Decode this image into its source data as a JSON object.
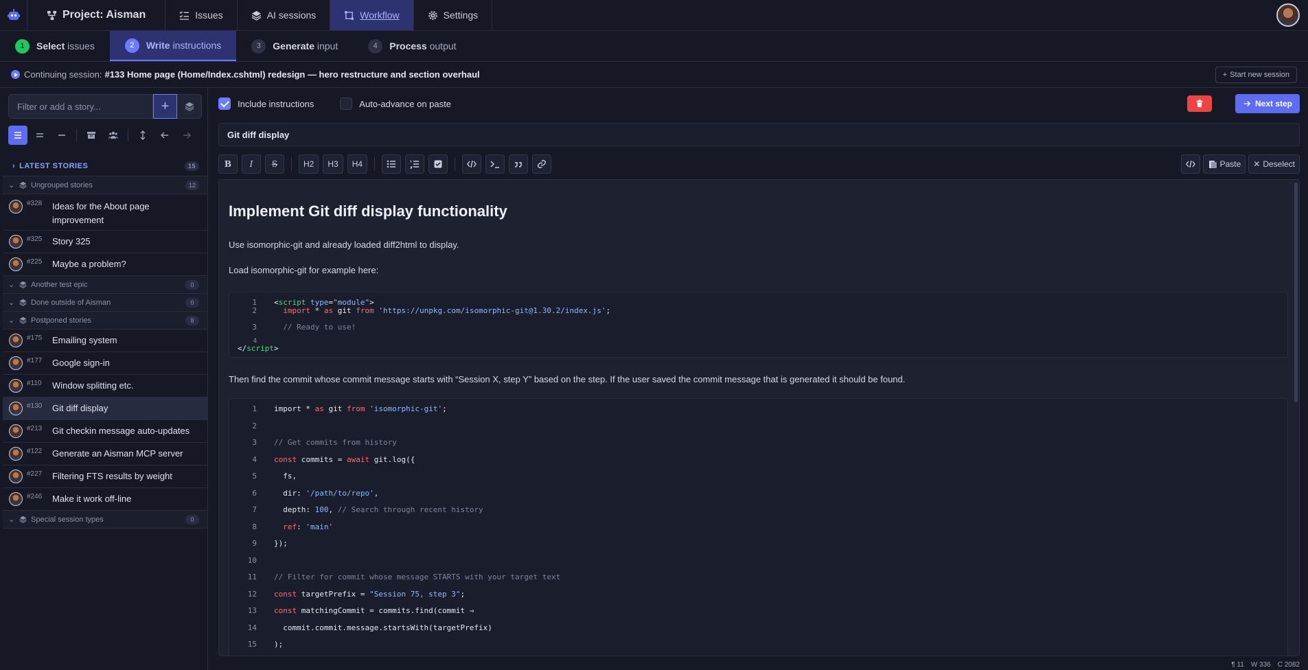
{
  "topnav": {
    "project": "Project: Aisman",
    "items": [
      {
        "label": "Issues",
        "icon": "list-check-icon"
      },
      {
        "label": "AI sessions",
        "icon": "layers-icon"
      },
      {
        "label": "Workflow",
        "icon": "workflow-icon",
        "active": true
      },
      {
        "label": "Settings",
        "icon": "gear-icon"
      }
    ]
  },
  "steps": [
    {
      "num": "1",
      "strong": "Select",
      "rest": "issues",
      "state": "done"
    },
    {
      "num": "2",
      "strong": "Write",
      "rest": "instructions",
      "state": "active"
    },
    {
      "num": "3",
      "strong": "Generate",
      "rest": "input",
      "state": "pending"
    },
    {
      "num": "4",
      "strong": "Process",
      "rest": "output",
      "state": "pending"
    }
  ],
  "session": {
    "prefix": "Continuing session:",
    "title": "#133 Home page (Home/Index.cshtml) redesign — hero restructure and section overhaul",
    "new_button": "Start new session"
  },
  "sidebar": {
    "filter_placeholder": "Filter or add a story...",
    "latest_label": "LATEST STORIES",
    "latest_count": "15",
    "groups": [
      {
        "label": "Ungrouped stories",
        "count": "12",
        "stories": [
          {
            "id": "#328",
            "title": "Ideas for the About page improvement"
          },
          {
            "id": "#325",
            "title": "Story 325"
          },
          {
            "id": "#225",
            "title": "Maybe a problem?"
          }
        ]
      },
      {
        "label": "Another test epic",
        "count": "0",
        "stories": []
      },
      {
        "label": "Done outside of Aisman",
        "count": "0",
        "stories": []
      },
      {
        "label": "Postponed stories",
        "count": "8",
        "stories": [
          {
            "id": "#175",
            "title": "Emailing system"
          },
          {
            "id": "#177",
            "title": "Google sign-in"
          },
          {
            "id": "#110",
            "title": "Window splitting etc."
          },
          {
            "id": "#130",
            "title": "Git diff display",
            "selected": true
          },
          {
            "id": "#213",
            "title": "Git checkin message auto-updates"
          },
          {
            "id": "#122",
            "title": "Generate an Aisman MCP server"
          },
          {
            "id": "#227",
            "title": "Filtering FTS results by weight"
          },
          {
            "id": "#246",
            "title": "Make it work off-line"
          }
        ]
      },
      {
        "label": "Special session types",
        "count": "0",
        "stories": []
      }
    ]
  },
  "main": {
    "include_instructions": "Include instructions",
    "auto_advance": "Auto-advance on paste",
    "next_step": "Next step",
    "story_title": "Git diff display",
    "toolbar": {
      "h2": "H2",
      "h3": "H3",
      "h4": "H4",
      "paste": "Paste",
      "deselect": "Deselect"
    },
    "doc": {
      "heading": "Implement Git diff display functionality",
      "p1": "Use isomorphic-git and already loaded diff2html to display.",
      "p2": "Load isomorphic-git for example here:",
      "p3": "Then find the commit whose commit message starts with “Session X, step Y” based on the step. If the user saved the commit message that is generated it should be found.",
      "code1_lines": [
        "1",
        "2",
        "3",
        "4"
      ],
      "code2_lines": [
        "1",
        "2",
        "3",
        "4",
        "5",
        "6",
        "7",
        "8",
        "9",
        "10",
        "11",
        "12",
        "13",
        "14",
        "15"
      ]
    }
  },
  "status": {
    "line": "¶ 11",
    "words": "W 336",
    "chars": "C 2082"
  }
}
